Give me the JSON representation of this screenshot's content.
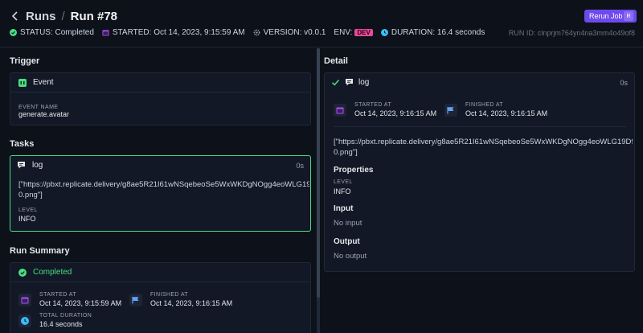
{
  "header": {
    "breadcrumb_runs": "Runs",
    "breadcrumb_sep": "/",
    "title": "Run #78",
    "rerun_label": "Rerun Job",
    "rerun_shortcut": "R",
    "run_id": "RUN ID: clnprjm764yn4na3mm4o49of8"
  },
  "meta": {
    "status": "STATUS: Completed",
    "started": "STARTED: Oct 14, 2023, 9:15:59 AM",
    "version": "VERSION: v0.0.1",
    "env_label": "ENV:",
    "env_value": "DEV",
    "duration": "DURATION: 16.4 seconds"
  },
  "trigger": {
    "section_title": "Trigger",
    "card_title": "Event",
    "field_label": "EVENT NAME",
    "field_value": "generate.avatar"
  },
  "tasks": {
    "section_title": "Tasks",
    "task_title": "log",
    "task_duration": "0s",
    "output_text_1": "[\"https://pbxt.replicate.delivery/g8ae5R21I61wNSqebeoSe5WxWKDgNOgg4eoWLG19",
    "output_text_2": "0.png\"]",
    "level_label": "LEVEL",
    "level_value": "INFO"
  },
  "summary": {
    "section_title": "Run Summary",
    "status": "Completed",
    "started_label": "STARTED AT",
    "started_value": "Oct 14, 2023, 9:15:59 AM",
    "finished_label": "FINISHED AT",
    "finished_value": "Oct 14, 2023, 9:16:15 AM",
    "duration_label": "TOTAL DURATION",
    "duration_value": "16.4 seconds"
  },
  "detail": {
    "section_title": "Detail",
    "title": "log",
    "duration": "0s",
    "started_label": "STARTED AT",
    "started_value": "Oct 14, 2023, 9:16:15 AM",
    "finished_label": "FINISHED AT",
    "finished_value": "Oct 14, 2023, 9:16:15 AM",
    "output_text_1": "[\"https://pbxt.replicate.delivery/g8ae5R21I61wNSqebeoSe5WxWKDgNOgg4eoWLG19D9",
    "output_text_2": "0.png\"]",
    "properties_title": "Properties",
    "level_label": "LEVEL",
    "level_value": "INFO",
    "input_title": "Input",
    "input_value": "No input",
    "output_title": "Output",
    "output_value": "No output"
  },
  "colors": {
    "accent": "#6d4aed",
    "success": "#4ade80",
    "env_badge": "#ec4899",
    "background": "#0d111a",
    "panel": "#121826"
  }
}
